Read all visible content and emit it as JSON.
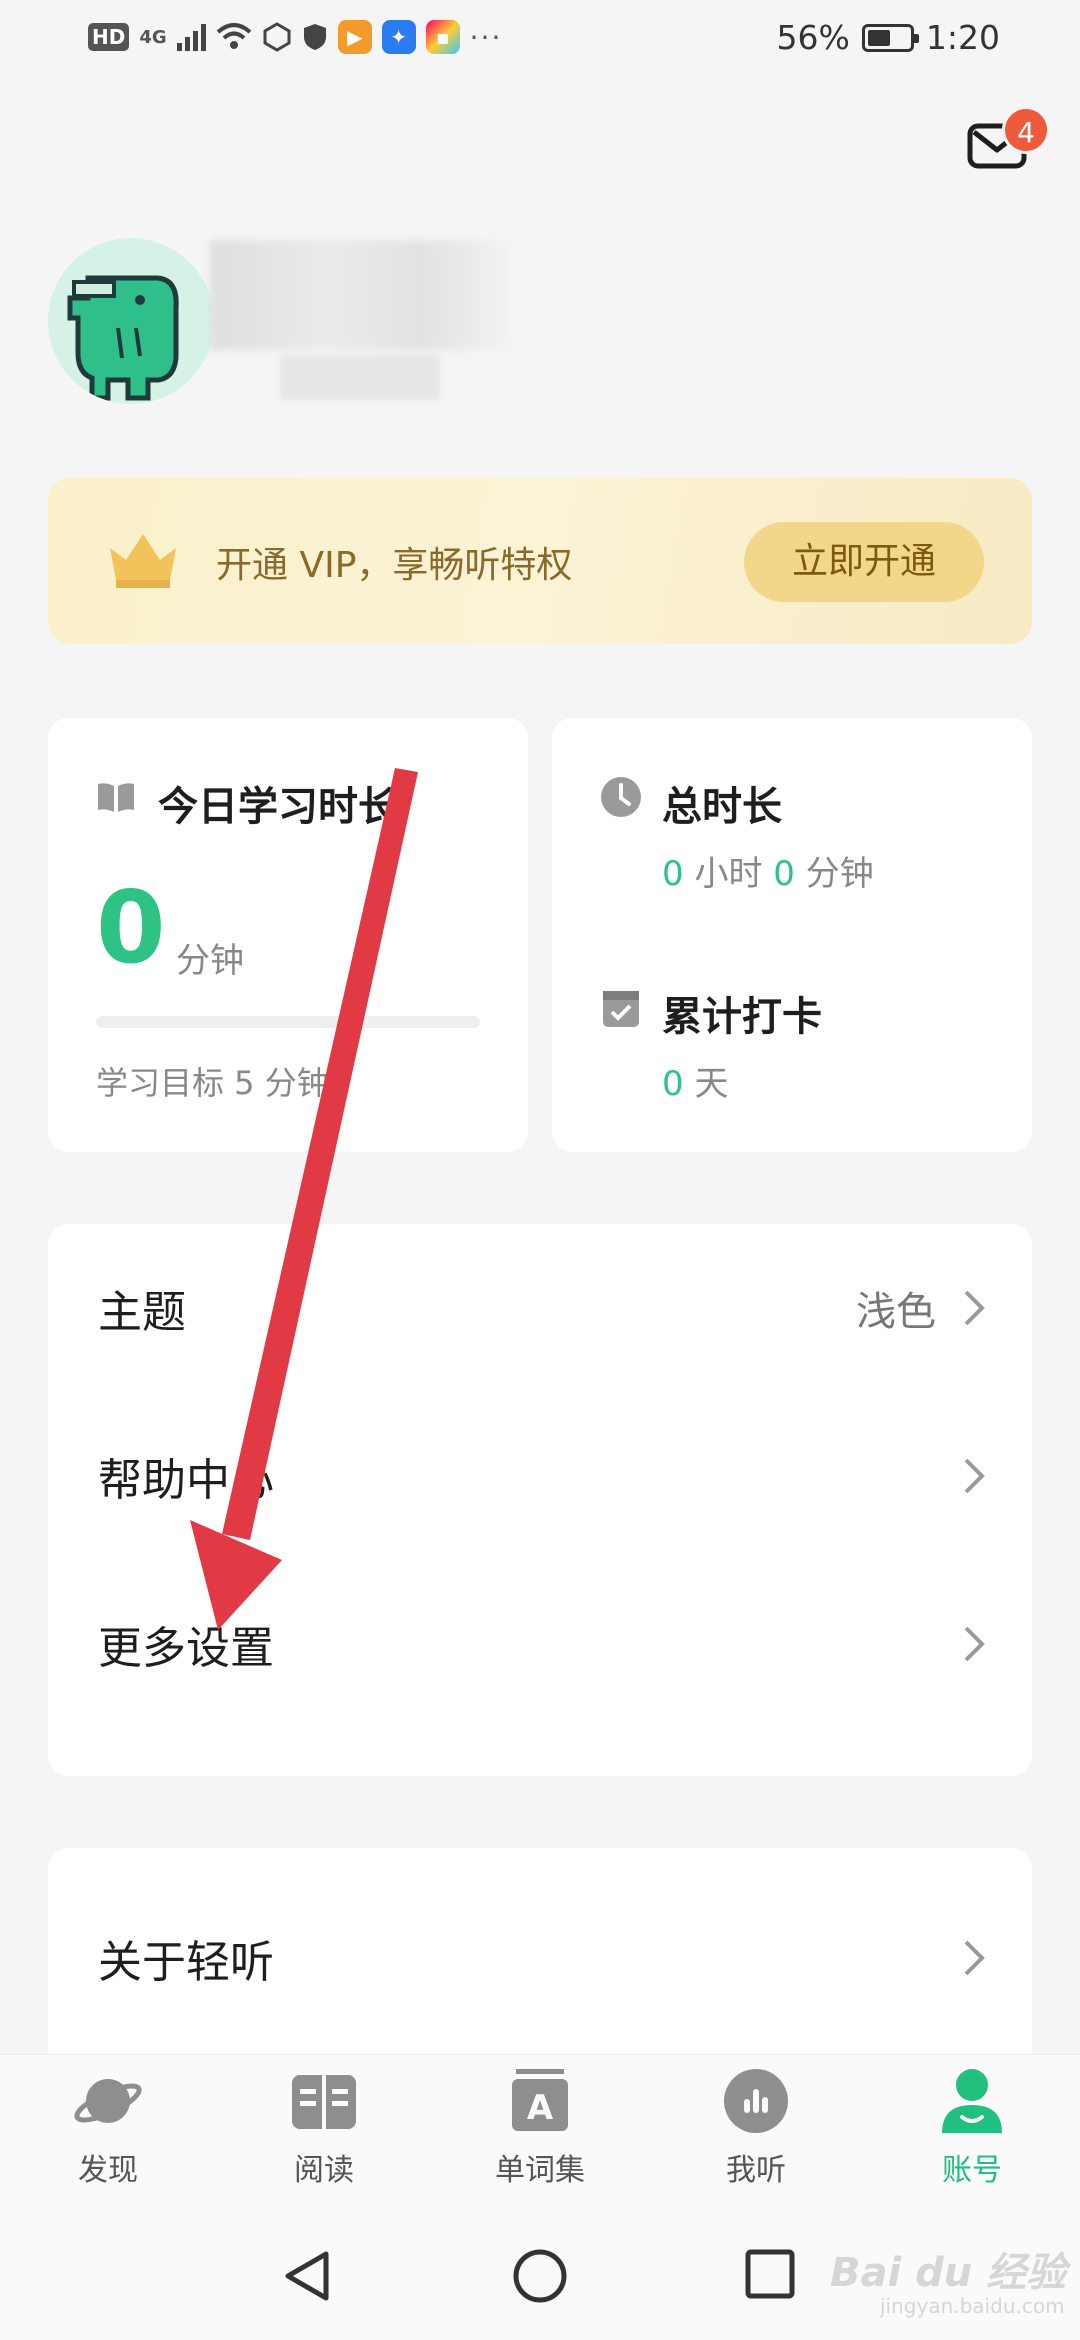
{
  "status_bar": {
    "hd": "HD",
    "network": "4G",
    "more": "···",
    "battery_percent": "56%",
    "battery_level": 0.56,
    "time": "1:20"
  },
  "header": {
    "message_badge": "4",
    "message_icon": "mail-icon"
  },
  "profile": {
    "avatar_icon": "dinosaur-avatar",
    "username_redacted": true
  },
  "vip_banner": {
    "icon": "crown-icon",
    "text": "开通 VIP，享畅听特权",
    "button": "立即开通"
  },
  "stats": {
    "today": {
      "title": "今日学习时长",
      "value": "0",
      "unit": "分钟",
      "progress": 0,
      "goal": "学习目标 5 分钟"
    },
    "total": {
      "title": "总时长",
      "hours": "0",
      "hours_unit": "小时",
      "minutes": "0",
      "minutes_unit": "分钟",
      "checkin_title": "累计打卡",
      "checkin_days": "0",
      "checkin_unit": "天"
    }
  },
  "menu": {
    "theme_label": "主题",
    "theme_value": "浅色",
    "help_label": "帮助中心",
    "more_settings_label": "更多设置",
    "about_label": "关于轻听"
  },
  "tabs": [
    {
      "label": "发现",
      "icon": "planet-icon"
    },
    {
      "label": "阅读",
      "icon": "book-icon"
    },
    {
      "label": "单词集",
      "icon": "word-book-icon"
    },
    {
      "label": "我听",
      "icon": "audio-bars-icon"
    },
    {
      "label": "账号",
      "icon": "account-icon"
    }
  ],
  "watermark": {
    "main": "Bai du 经验",
    "sub": "jingyan.baidu.com"
  },
  "colors": {
    "accent_green": "#2ec285",
    "arrow_red": "#e23a44",
    "vip_gold": "#f2d68a",
    "badge_red": "#ee5a3c"
  }
}
